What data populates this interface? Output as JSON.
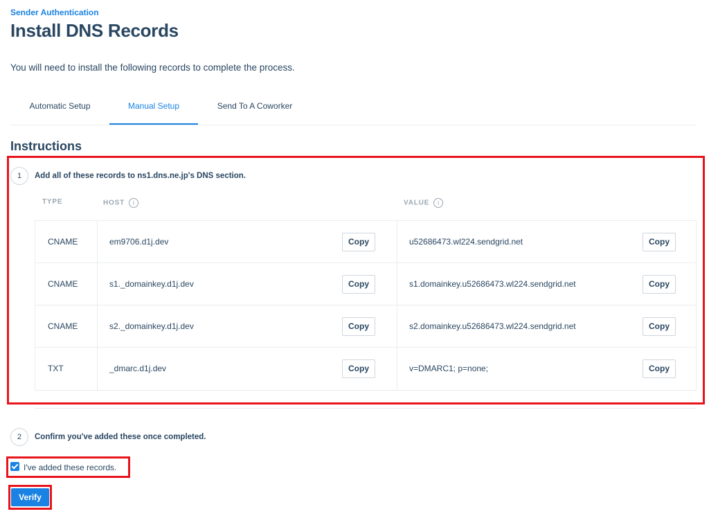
{
  "header": {
    "eyebrow": "Sender Authentication",
    "title": "Install DNS Records",
    "subtitle": "You will need to install the following records to complete the process."
  },
  "tabs": [
    {
      "label": "Automatic Setup",
      "active": false
    },
    {
      "label": "Manual Setup",
      "active": true
    },
    {
      "label": "Send To A Coworker",
      "active": false
    }
  ],
  "instructions": {
    "heading": "Instructions",
    "step1": {
      "number": "1",
      "text": "Add all of these records to ns1.dns.ne.jp's DNS section."
    },
    "step2": {
      "number": "2",
      "text": "Confirm you've added these once completed."
    }
  },
  "table": {
    "headers": {
      "type": "TYPE",
      "host": "HOST",
      "value": "VALUE"
    },
    "copy_label": "Copy",
    "rows": [
      {
        "type": "CNAME",
        "host": "em9706.d1j.dev",
        "value": "u52686473.wl224.sendgrid.net"
      },
      {
        "type": "CNAME",
        "host": "s1._domainkey.d1j.dev",
        "value": "s1.domainkey.u52686473.wl224.sendgrid.net"
      },
      {
        "type": "CNAME",
        "host": "s2._domainkey.d1j.dev",
        "value": "s2.domainkey.u52686473.wl224.sendgrid.net"
      },
      {
        "type": "TXT",
        "host": "_dmarc.d1j.dev",
        "value": "v=DMARC1; p=none;"
      }
    ]
  },
  "confirm": {
    "checkbox_label": "I've added these records.",
    "checked": true
  },
  "verify_label": "Verify",
  "colors": {
    "accent": "#1a82e2",
    "text": "#294661",
    "highlight": "#e8141c"
  },
  "icons": {
    "info": "info-icon",
    "check": "checkmark-icon"
  }
}
